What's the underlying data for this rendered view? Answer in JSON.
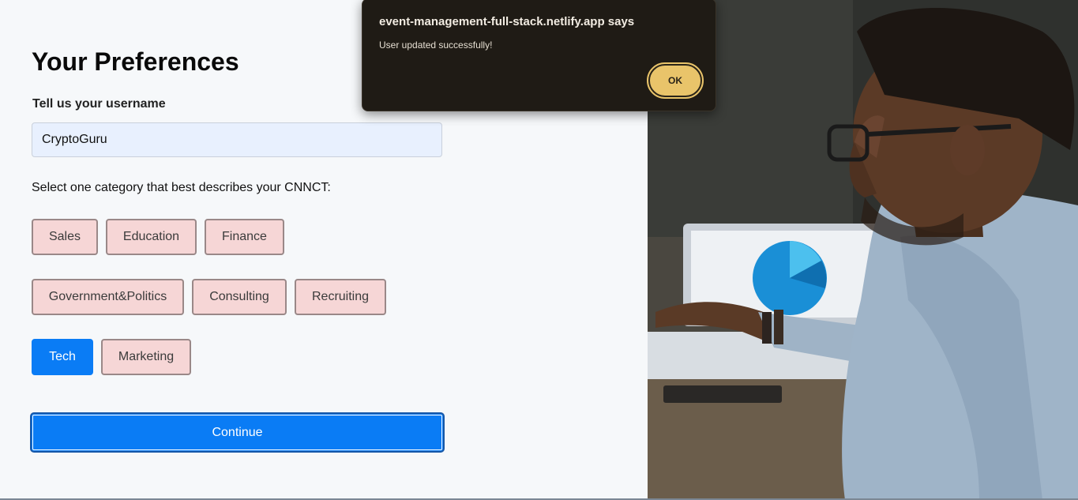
{
  "alert": {
    "title": "event-management-full-stack.netlify.app says",
    "message": "User updated successfully!",
    "ok_label": "OK"
  },
  "form": {
    "title": "Your Preferences",
    "username_label": "Tell us your username",
    "username_value": "CryptoGuru",
    "category_prompt": "Select one category that best describes your CNNCT:",
    "categories": [
      {
        "label": "Sales",
        "selected": false
      },
      {
        "label": "Education",
        "selected": false
      },
      {
        "label": "Finance",
        "selected": false
      },
      {
        "label": "Government&Politics",
        "selected": false
      },
      {
        "label": "Consulting",
        "selected": false
      },
      {
        "label": "Recruiting",
        "selected": false
      },
      {
        "label": "Tech",
        "selected": true
      },
      {
        "label": "Marketing",
        "selected": false
      }
    ],
    "continue_label": "Continue"
  },
  "hero": {
    "description_icon": "man-at-computer-photo"
  },
  "colors": {
    "accent": "#0a7cf5",
    "category_bg": "#f6d6d6",
    "alert_bg": "#1f1b15",
    "alert_button": "#e9c46a"
  }
}
